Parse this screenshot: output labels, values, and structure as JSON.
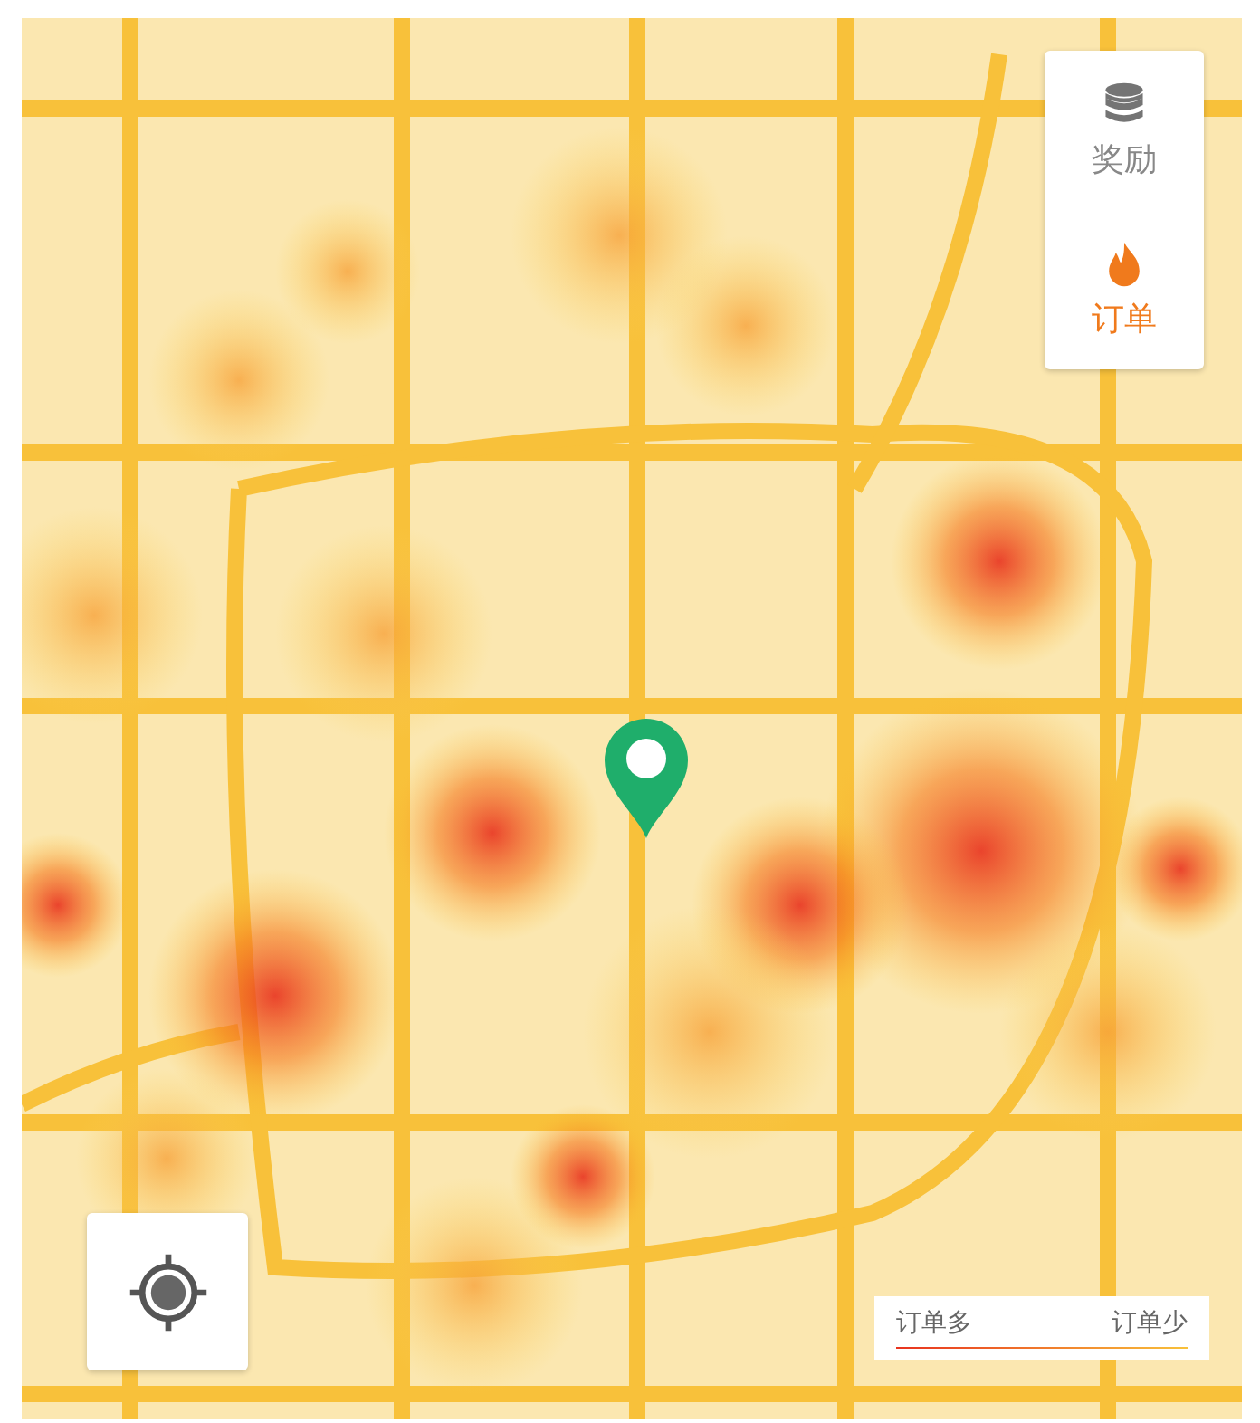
{
  "layer_panel": {
    "items": [
      {
        "kind": "reward",
        "label": "奖励",
        "selected": false
      },
      {
        "kind": "orders",
        "label": "订单",
        "selected": true
      }
    ]
  },
  "legend": {
    "high_label": "订单多",
    "low_label": "订单少"
  }
}
